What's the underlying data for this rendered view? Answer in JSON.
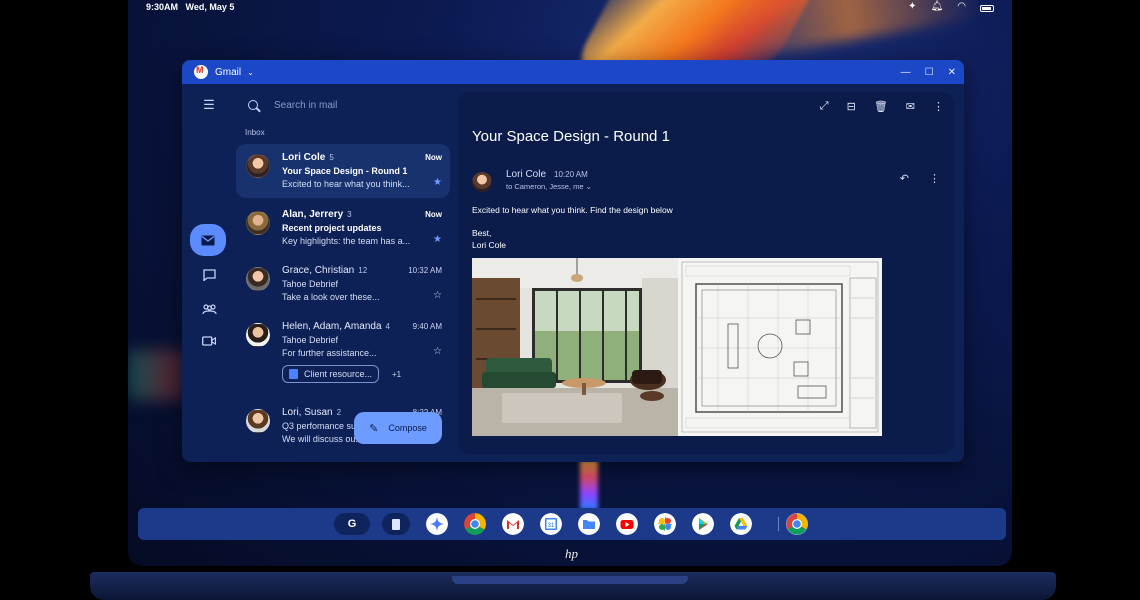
{
  "status": {
    "time": "9:30AM",
    "date": "Wed, May 5",
    "icons": [
      "sparkle-icon",
      "bell-icon",
      "wifi-icon",
      "battery-icon"
    ]
  },
  "window": {
    "app_name": "Gmail",
    "controls": [
      "minimize-icon",
      "maximize-icon",
      "close-icon"
    ]
  },
  "search": {
    "placeholder": "Search in mail"
  },
  "inbox_label": "Inbox",
  "emails": [
    {
      "sender": "Lori Cole",
      "count": "5",
      "time": "Now",
      "subject": "Your Space Design - Round 1",
      "snippet": "Excited to hear what you think...",
      "starred": true,
      "unread": true
    },
    {
      "sender": "Alan, Jerrery",
      "count": "3",
      "time": "Now",
      "subject": "Recent project updates",
      "snippet": "Key highlights: the team has a...",
      "starred": true,
      "unread": true
    },
    {
      "sender": "Grace, Christian",
      "count": "12",
      "time": "10:32 AM",
      "subject": "Tahoe Debrief",
      "snippet": "Take a look over these...",
      "starred": false,
      "unread": false
    },
    {
      "sender": "Helen, Adam, Amanda",
      "count": "4",
      "time": "9:40 AM",
      "subject": "Tahoe Debrief",
      "snippet": "For further assistance...",
      "starred": false,
      "unread": false,
      "attachment": "Client resource...",
      "attachment_more": "+1"
    },
    {
      "sender": "Lori, Susan",
      "count": "2",
      "time": "8:22 AM",
      "subject": "Q3 perfomance su...",
      "snippet": "We will discuss ou...",
      "starred": false,
      "unread": false
    }
  ],
  "compose_label": "Compose",
  "message": {
    "subject": "Your Space Design - Round 1",
    "from": "Lori Cole",
    "time": "10:20 AM",
    "to": "to Cameron, Jesse, me",
    "body": "Excited to hear what you think. Find the design below",
    "sign_off": "Best,",
    "signature": "Lori Cole"
  },
  "shelf": {
    "launcher_label": "G",
    "apps": [
      {
        "name": "gemini-icon",
        "color": "#ffffff"
      },
      {
        "name": "chrome-icon",
        "color": "#ffffff"
      },
      {
        "name": "gmail-icon",
        "color": "#ffffff"
      },
      {
        "name": "calendar-icon",
        "color": "#ffffff",
        "label": "31"
      },
      {
        "name": "files-icon",
        "color": "#ffffff"
      },
      {
        "name": "youtube-icon",
        "color": "#ffffff"
      },
      {
        "name": "photos-icon",
        "color": "#ffffff"
      },
      {
        "name": "play-store-icon",
        "color": "#ffffff"
      },
      {
        "name": "drive-icon",
        "color": "#ffffff"
      }
    ]
  },
  "brand": "hp"
}
